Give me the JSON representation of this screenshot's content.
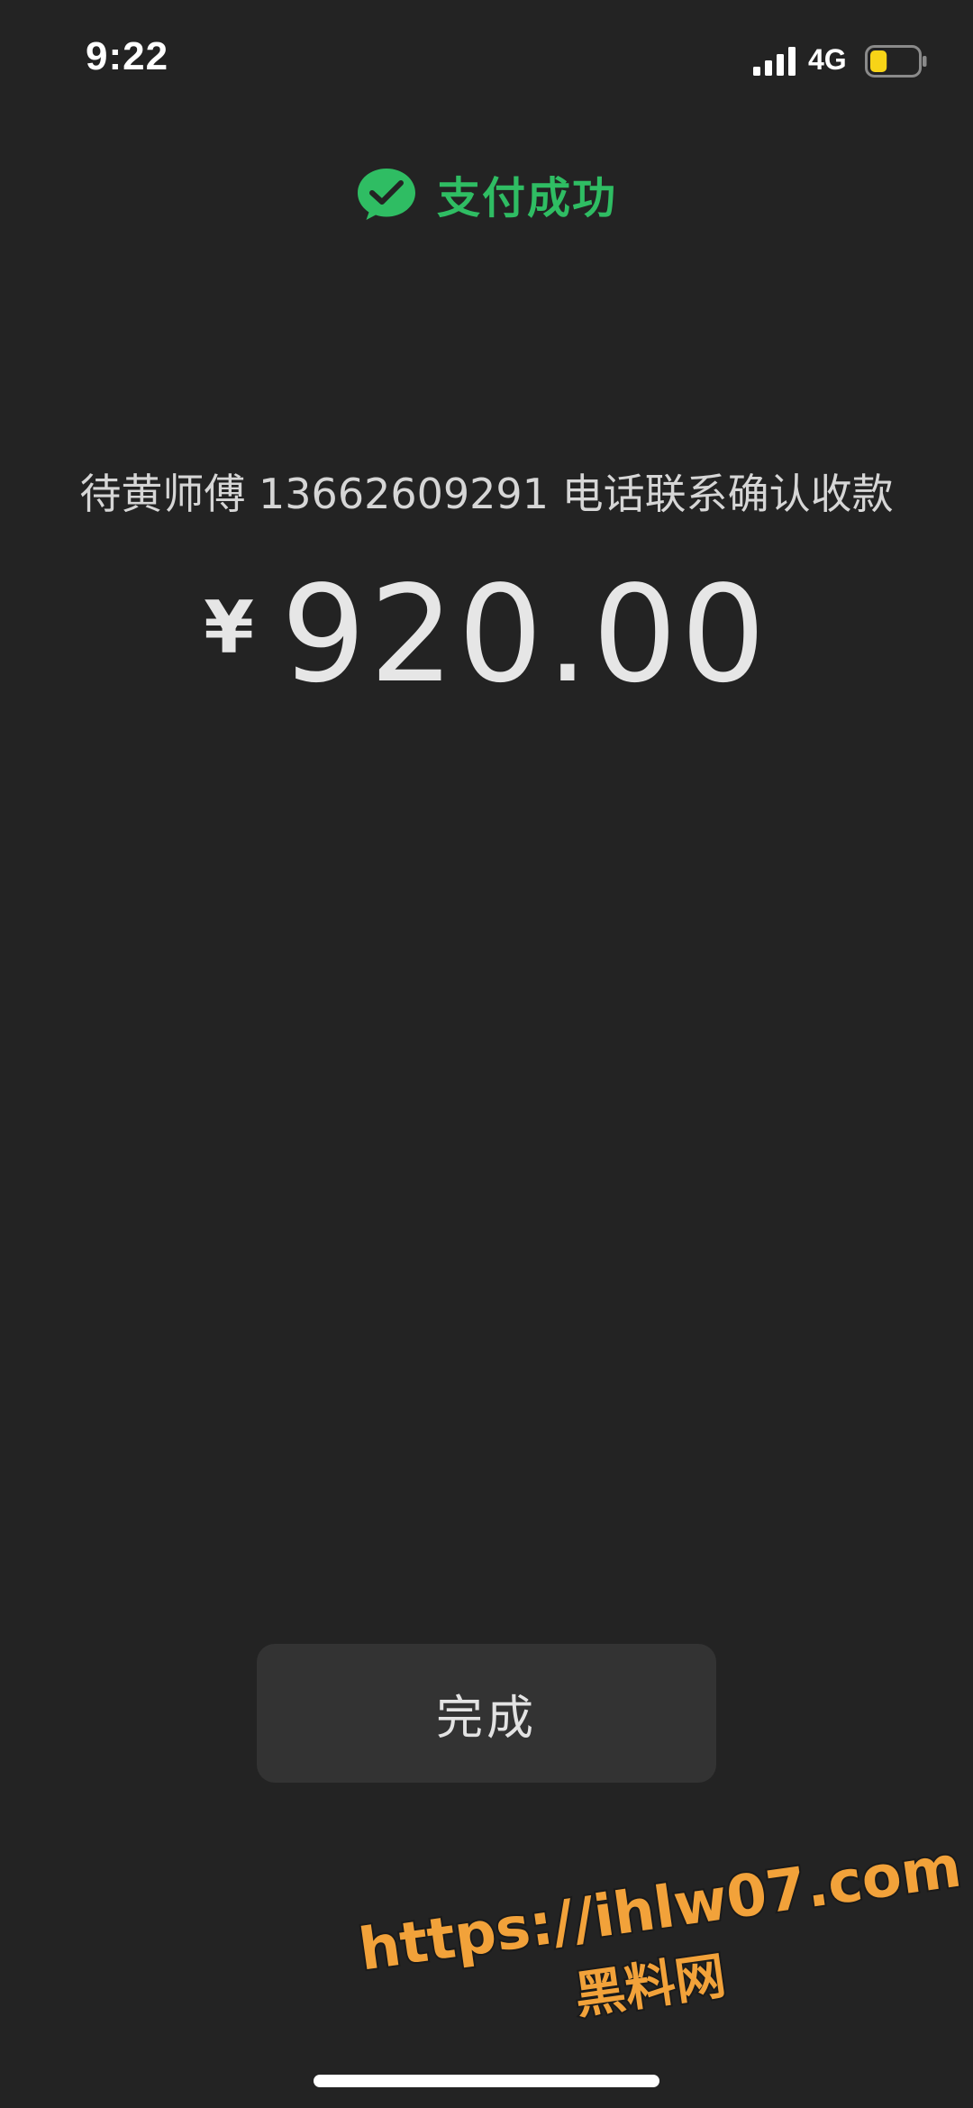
{
  "status_bar": {
    "time": "9:22",
    "network": "4G",
    "battery_level": 0.35,
    "battery_color": "#f7d417"
  },
  "header": {
    "icon": "wechat-pay-check-icon",
    "title": "支付成功",
    "accent_color": "#2fbd63"
  },
  "payment": {
    "payee": "待黄师傅 13662609291 电话联系确认收款",
    "currency_symbol": "¥",
    "amount": "920.00"
  },
  "actions": {
    "done_label": "完成"
  },
  "watermark": {
    "url": "https://ihlw07.com",
    "name": "黑料网"
  }
}
